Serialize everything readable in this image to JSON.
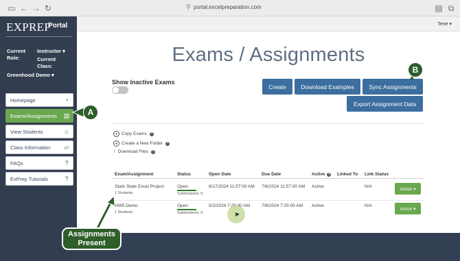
{
  "browser": {
    "url": "portal.excelpreparation.com"
  },
  "sidebar": {
    "brand": "EXPREP",
    "brand_sub": "Portal",
    "current_role_label": "Current Role:",
    "current_role_value": "Instructor",
    "current_class_label": "Current Class:",
    "current_class_value": "Greenhood Demo",
    "items": [
      {
        "label": "Homepage",
        "icon": "dashboard-icon"
      },
      {
        "label": "Exams/Assignments",
        "icon": "document-icon"
      },
      {
        "label": "View Students",
        "icon": "institution-icon"
      },
      {
        "label": "Class Information",
        "icon": "folder-icon"
      },
      {
        "label": "FAQs",
        "icon": "question-icon"
      },
      {
        "label": "ExPrep Tutorials",
        "icon": "question-icon"
      }
    ],
    "active_index": 1
  },
  "topbar": {
    "user": "Tene"
  },
  "main": {
    "title": "Exams / Assignments",
    "show_inactive_label": "Show Inactive Exams",
    "buttons": {
      "create": "Create",
      "download_examples": "Download Examples",
      "sync_assignments": "Sync Assignments",
      "export_assignment_data": "Export Assignment Data"
    },
    "tools": {
      "copy_exams": "Copy Exams",
      "create_folder": "Create a New Folder",
      "download_files": "Download Files"
    },
    "table": {
      "headers": [
        "Exam/Assignment",
        "Status",
        "Open Date",
        "Due Date",
        "Active",
        "Linked To",
        "Link Status"
      ],
      "rows": [
        {
          "name": "Stark State Excel Project",
          "students": "1 Students",
          "status": "Open",
          "submissions": "Submissions: 0",
          "open_date": "6/17/2024 11:57:00 AM",
          "due_date": "7/6/2024 11:57:00 AM",
          "active": "Active",
          "linked_to": "",
          "link_status": "N/A",
          "action": "Action ▾"
        },
        {
          "name": "HW5 Demo",
          "students": "1 Students",
          "status": "Open",
          "submissions": "Submissions: 0",
          "open_date": "5/2/2024 7:25:00 AM",
          "due_date": "7/6/2024 7:25:00 AM",
          "active": "Active",
          "linked_to": "",
          "link_status": "N/A",
          "action": "Action ▾"
        }
      ]
    }
  },
  "annotations": {
    "badge_a": "A",
    "badge_b": "B",
    "callout": "Assignments Present",
    "colors": {
      "badge": "#2e5e2a",
      "accent_green": "#6aa84f",
      "button_blue": "#3c6e9f"
    }
  }
}
